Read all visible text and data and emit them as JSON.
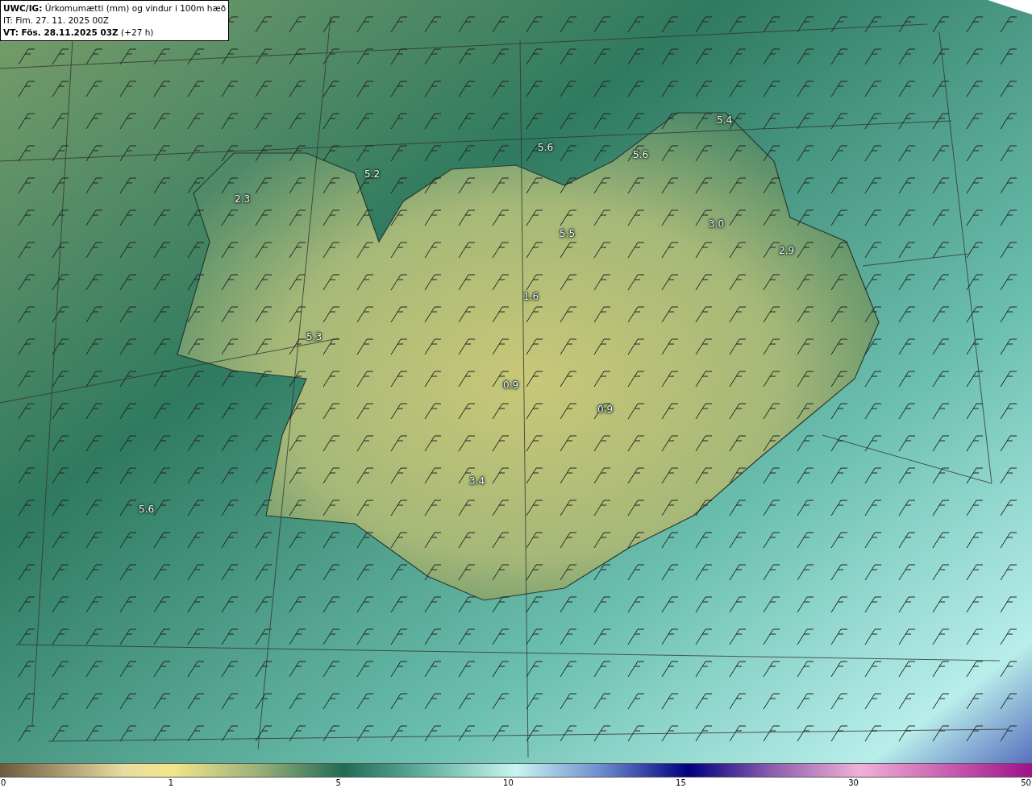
{
  "header": {
    "title": "**UWC/IG:** Úrkomumætti (mm) og vindur i 100m hæð",
    "issued": "IT: Fim. 27. 11. 2025 00Z",
    "valid": "**VT: Fös. 28.11.2025 03Z** (+27 h)"
  },
  "map_labels": [
    "5.4",
    "5.6",
    "5.6",
    "5.2",
    "2.3",
    "3.0",
    "2.9",
    "5.5",
    "1.6",
    "5.3",
    "0.9",
    "0.9",
    "3.4",
    "5.6"
  ],
  "colorbar": {
    "ticks": [
      "0",
      "1",
      "5",
      "10",
      "15",
      "30",
      "50"
    ]
  }
}
